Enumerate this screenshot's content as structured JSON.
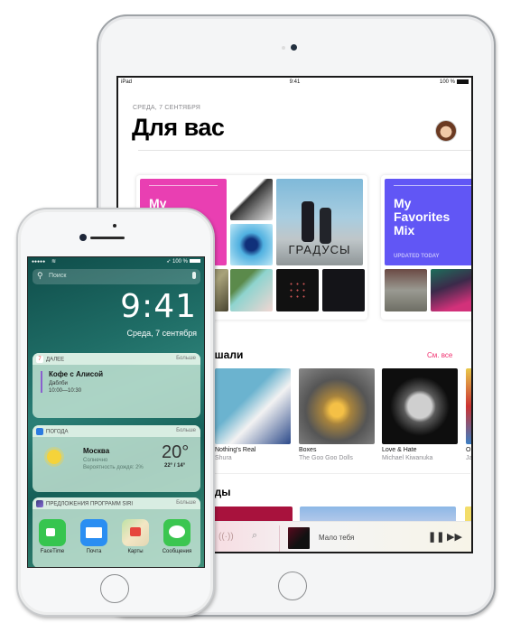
{
  "ipad": {
    "status_bar": {
      "carrier": "iPad",
      "time": "9:41",
      "battery": "100 %"
    },
    "date_label": "СРЕДА, 7 СЕНТЯБРЯ",
    "page_title": "Для вас",
    "mixes": [
      {
        "title": "My Music Mix",
        "visible_title": "My\nMusic",
        "color": "#e93fb2"
      },
      {
        "title": "My Favorites Mix",
        "visible_title": "My\nFavorites\nMix",
        "subtitle": "UPDATED TODAY",
        "color": "#6156f5"
      }
    ],
    "featured_album_text": "ГРАДУСЫ",
    "recently_played": {
      "title": "ушали",
      "see_all": "См. все",
      "albums": [
        {
          "title": "Nothing's Real",
          "artist": "Shura"
        },
        {
          "title": "Boxes",
          "artist": "The Goo Goo Dolls"
        },
        {
          "title": "Love & Hate",
          "artist": "Michael Kiwanuka"
        },
        {
          "title": "O",
          "artist": "Ja"
        }
      ]
    },
    "second_section_title": "еды",
    "player": {
      "track": "Мало тебя",
      "pause_icon": "⏸",
      "next_icon": "⏭"
    }
  },
  "iphone": {
    "status_bar": {
      "signal": "●●●●●",
      "battery": "100 %"
    },
    "search_placeholder": "Поиск",
    "time": "9:41",
    "date": "Среда, 7 сентября",
    "widgets": {
      "upnext": {
        "header": "ДАЛЕЕ",
        "more": "Больше",
        "event": "Кофе с Алисой",
        "location": "Даблби",
        "time": "10:00—10:30",
        "icon_text": "7"
      },
      "weather": {
        "header": "ПОГОДА",
        "more": "Больше",
        "city": "Москва",
        "condition": "Солнечно",
        "rain": "Вероятность дождя: 2%",
        "temp": "20°",
        "range": "22° / 14°"
      },
      "siri": {
        "header": "ПРЕДЛОЖЕНИЯ ПРОГРАММ SIRI",
        "more": "Больше",
        "apps": [
          {
            "label": "FaceTime",
            "color": "#36c54f"
          },
          {
            "label": "Почта",
            "color": "#2a8ef2"
          },
          {
            "label": "Карты",
            "color": "#e9e1c9"
          },
          {
            "label": "Сообщения",
            "color": "#3bc650"
          }
        ]
      }
    }
  }
}
